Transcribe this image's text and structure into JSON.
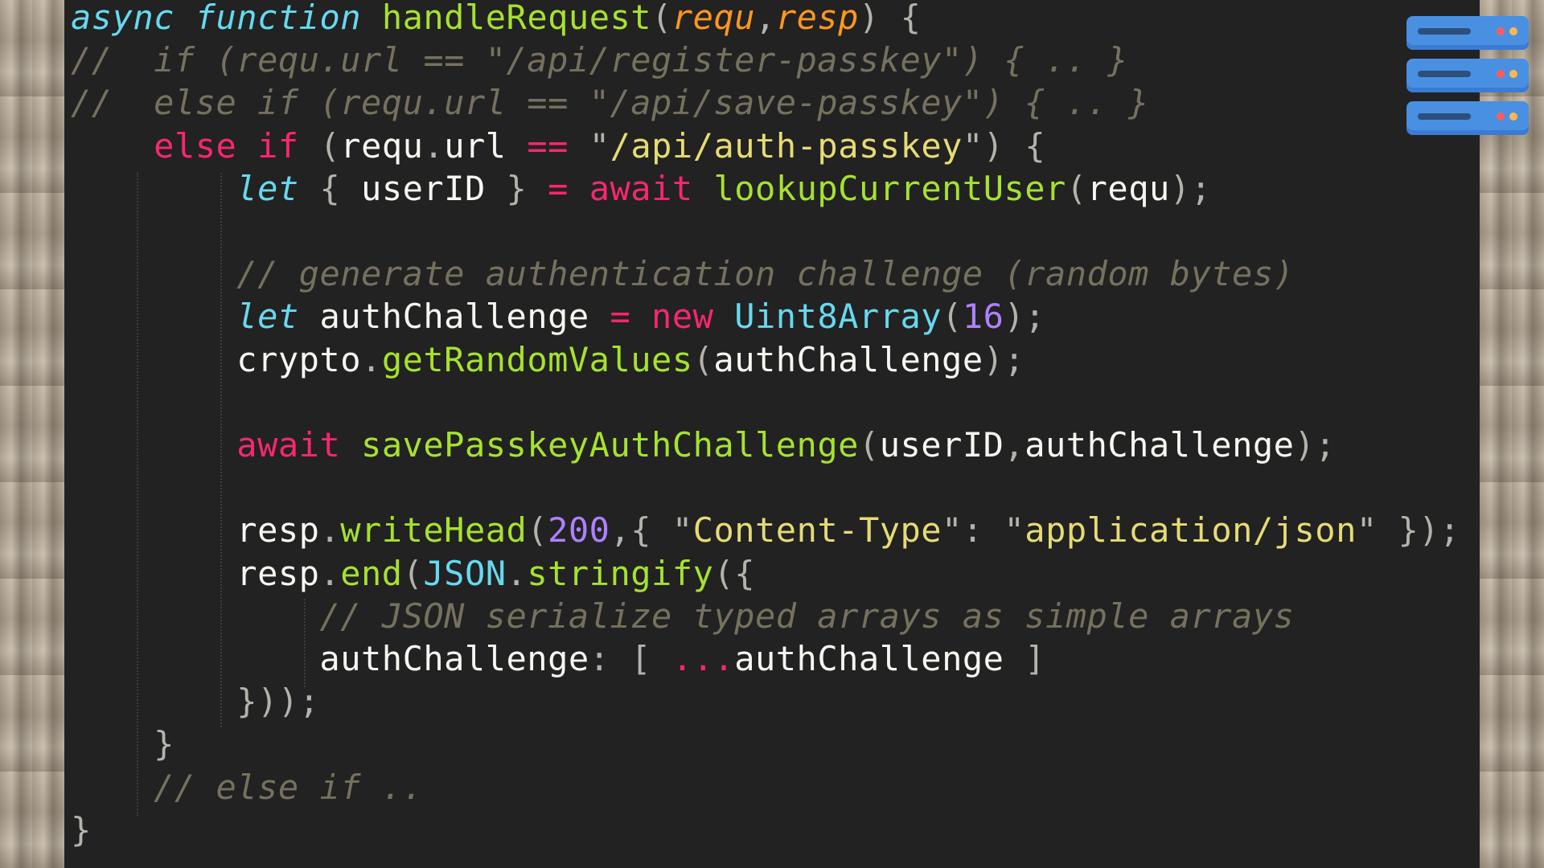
{
  "icon": {
    "name": "server-icon"
  },
  "code_lines": [
    [
      [
        "st",
        "async"
      ],
      [
        "tx",
        " "
      ],
      [
        "st",
        "function"
      ],
      [
        "tx",
        " "
      ],
      [
        "fn",
        "handleRequest"
      ],
      [
        "pu",
        "("
      ],
      [
        "pa",
        "requ"
      ],
      [
        "pu",
        ","
      ],
      [
        "pa",
        "resp"
      ],
      [
        "pu",
        ")"
      ],
      [
        "tx",
        " "
      ],
      [
        "pu",
        "{"
      ]
    ],
    [
      [
        "cm",
        "//  if (requ.url == \"/api/register-passkey\") { .. }"
      ]
    ],
    [
      [
        "cm",
        "//  else if (requ.url == \"/api/save-passkey\") { .. }"
      ]
    ],
    [
      [
        "tx",
        "    "
      ],
      [
        "kw",
        "else"
      ],
      [
        "tx",
        " "
      ],
      [
        "kw",
        "if"
      ],
      [
        "tx",
        " "
      ],
      [
        "pu",
        "("
      ],
      [
        "tx",
        "requ"
      ],
      [
        "pu",
        "."
      ],
      [
        "tx",
        "url"
      ],
      [
        "tx",
        " "
      ],
      [
        "kw",
        "=="
      ],
      [
        "tx",
        " "
      ],
      [
        "pu",
        "\""
      ],
      [
        "sr",
        "/api/auth-passkey"
      ],
      [
        "pu",
        "\""
      ],
      [
        "pu",
        ")"
      ],
      [
        "tx",
        " "
      ],
      [
        "pu",
        "{"
      ]
    ],
    [
      [
        "tx",
        "        "
      ],
      [
        "st",
        "let"
      ],
      [
        "tx",
        " "
      ],
      [
        "pu",
        "{"
      ],
      [
        "tx",
        " userID "
      ],
      [
        "pu",
        "}"
      ],
      [
        "tx",
        " "
      ],
      [
        "kw",
        "="
      ],
      [
        "tx",
        " "
      ],
      [
        "kw",
        "await"
      ],
      [
        "tx",
        " "
      ],
      [
        "fn",
        "lookupCurrentUser"
      ],
      [
        "pu",
        "("
      ],
      [
        "tx",
        "requ"
      ],
      [
        "pu",
        ")"
      ],
      [
        "pu",
        ";"
      ]
    ],
    [
      [
        "tx",
        ""
      ]
    ],
    [
      [
        "tx",
        "        "
      ],
      [
        "cm",
        "// generate authentication challenge (random bytes)"
      ]
    ],
    [
      [
        "tx",
        "        "
      ],
      [
        "st",
        "let"
      ],
      [
        "tx",
        " authChallenge "
      ],
      [
        "kw",
        "="
      ],
      [
        "tx",
        " "
      ],
      [
        "kw",
        "new"
      ],
      [
        "tx",
        " "
      ],
      [
        "cl",
        "Uint8Array"
      ],
      [
        "pu",
        "("
      ],
      [
        "nu",
        "16"
      ],
      [
        "pu",
        ")"
      ],
      [
        "pu",
        ";"
      ]
    ],
    [
      [
        "tx",
        "        crypto"
      ],
      [
        "pu",
        "."
      ],
      [
        "fn",
        "getRandomValues"
      ],
      [
        "pu",
        "("
      ],
      [
        "tx",
        "authChallenge"
      ],
      [
        "pu",
        ")"
      ],
      [
        "pu",
        ";"
      ]
    ],
    [
      [
        "tx",
        ""
      ]
    ],
    [
      [
        "tx",
        "        "
      ],
      [
        "kw",
        "await"
      ],
      [
        "tx",
        " "
      ],
      [
        "fn",
        "savePasskeyAuthChallenge"
      ],
      [
        "pu",
        "("
      ],
      [
        "tx",
        "userID"
      ],
      [
        "pu",
        ","
      ],
      [
        "tx",
        "authChallenge"
      ],
      [
        "pu",
        ")"
      ],
      [
        "pu",
        ";"
      ]
    ],
    [
      [
        "tx",
        ""
      ]
    ],
    [
      [
        "tx",
        "        resp"
      ],
      [
        "pu",
        "."
      ],
      [
        "fn",
        "writeHead"
      ],
      [
        "pu",
        "("
      ],
      [
        "nu",
        "200"
      ],
      [
        "pu",
        ","
      ],
      [
        "pu",
        "{"
      ],
      [
        "tx",
        " "
      ],
      [
        "pu",
        "\""
      ],
      [
        "sr",
        "Content-Type"
      ],
      [
        "pu",
        "\""
      ],
      [
        "pu",
        ":"
      ],
      [
        "tx",
        " "
      ],
      [
        "pu",
        "\""
      ],
      [
        "sr",
        "application/json"
      ],
      [
        "pu",
        "\""
      ],
      [
        "tx",
        " "
      ],
      [
        "pu",
        "}"
      ],
      [
        "pu",
        ")"
      ],
      [
        "pu",
        ";"
      ]
    ],
    [
      [
        "tx",
        "        resp"
      ],
      [
        "pu",
        "."
      ],
      [
        "fn",
        "end"
      ],
      [
        "pu",
        "("
      ],
      [
        "cl",
        "JSON"
      ],
      [
        "pu",
        "."
      ],
      [
        "fn",
        "stringify"
      ],
      [
        "pu",
        "("
      ],
      [
        "pu",
        "{"
      ]
    ],
    [
      [
        "tx",
        "            "
      ],
      [
        "cm",
        "// JSON serialize typed arrays as simple arrays"
      ]
    ],
    [
      [
        "tx",
        "            authChallenge"
      ],
      [
        "pu",
        ":"
      ],
      [
        "tx",
        " "
      ],
      [
        "pu",
        "["
      ],
      [
        "tx",
        " "
      ],
      [
        "kw",
        "..."
      ],
      [
        "tx",
        "authChallenge "
      ],
      [
        "pu",
        "]"
      ]
    ],
    [
      [
        "tx",
        "        "
      ],
      [
        "pu",
        "}"
      ],
      [
        "pu",
        ")"
      ],
      [
        "pu",
        ")"
      ],
      [
        "pu",
        ";"
      ]
    ],
    [
      [
        "tx",
        "    "
      ],
      [
        "pu",
        "}"
      ]
    ],
    [
      [
        "tx",
        "    "
      ],
      [
        "cm",
        "// else if .."
      ]
    ],
    [
      [
        "pu",
        "}"
      ]
    ]
  ]
}
